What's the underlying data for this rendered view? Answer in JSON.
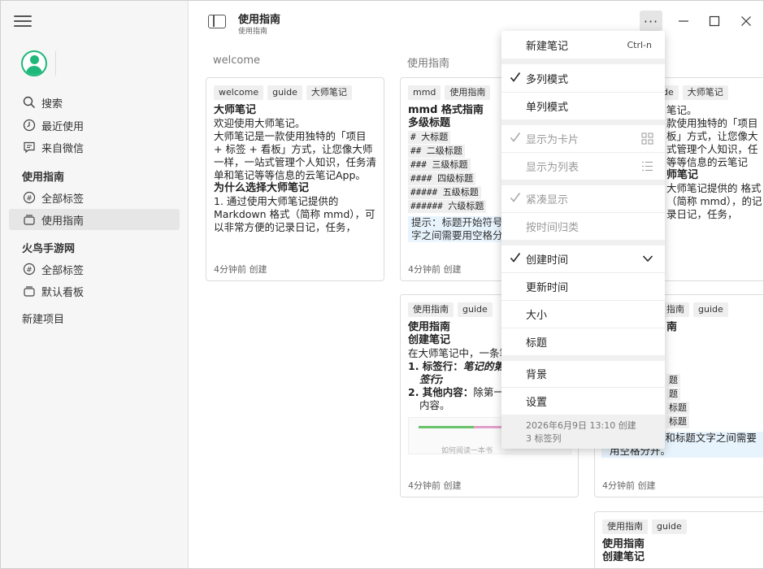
{
  "sidebar": {
    "nav_top": [
      {
        "label": "搜索",
        "icon": "search-icon"
      },
      {
        "label": "最近使用",
        "icon": "clock-icon"
      },
      {
        "label": "来自微信",
        "icon": "chat-icon"
      }
    ],
    "sections": [
      {
        "title": "使用指南",
        "items": [
          {
            "label": "全部标签",
            "icon": "tag-icon"
          },
          {
            "label": "使用指南",
            "icon": "board-icon",
            "active": true
          }
        ]
      },
      {
        "title": "火鸟手游网",
        "items": [
          {
            "label": "全部标签",
            "icon": "tag-icon"
          },
          {
            "label": "默认看板",
            "icon": "board-icon"
          }
        ]
      }
    ],
    "new_project": "新建项目"
  },
  "header": {
    "title": "使用指南",
    "subtitle": "使用指南",
    "more": "···"
  },
  "columns": [
    {
      "title": "welcome"
    },
    {
      "title": "使用指南"
    }
  ],
  "cards": {
    "c1": {
      "tags": [
        "welcome",
        "guide",
        "大师笔记"
      ],
      "title": "大师笔记",
      "lines": [
        "欢迎使用大师笔记。",
        "大师笔记是一款使用独特的「项目 + 标签 + 看板」方式，让您像大师一样，一站式管理个人知识，任务清单和笔记等等信息的云笔记App。"
      ],
      "h2": "为什么选择大师笔记",
      "p2": "1. 通过使用大师笔记提供的 Markdown 格式（简称 mmd），可以非常方便的记录日记，任务，",
      "footer": "4分钟前 创建"
    },
    "c2": {
      "tags": [
        "mmd",
        "使用指南"
      ],
      "title": "mmd 格式指南",
      "h2": "多级标题",
      "code": [
        "# 大标题",
        "## 二级标题",
        "### 三级标题",
        "#### 四级标题",
        "##### 五级标题",
        "###### 六级标题"
      ],
      "tip": "提示：标题开始符号 # 和标题文字之间需要用空格分开。",
      "footer": "4分钟前 创建"
    },
    "c3": {
      "tags": [
        "guide",
        "大师笔记"
      ],
      "lines": [
        "笔记。",
        "款使用独特的「项目",
        "板」方式，让您像大",
        "式管理个人知识，任",
        "等等信息的云笔记"
      ],
      "h2": "师笔记",
      "p2": "大师笔记提供的 格式（简称 mmd），的记录日记，任务，",
      "footer": ""
    },
    "c4": {
      "tags": [
        "使用指南",
        "guide"
      ],
      "title": "使用指南",
      "h2": "创建笔记",
      "p1": "在大师笔记中，一条笔记构成：",
      "li1_a": "1. 标签行：",
      "li1_b": "笔记的第",
      "li1_c": "签行;",
      "li2_a": "2. 其他内容：",
      "li2_b": "除第一",
      "li2_c": "内容。",
      "thumb_caption": "如何阅读一本书",
      "footer": "4分钟前 创建"
    },
    "c5": {
      "tags": [
        "指南",
        "guide"
      ],
      "title": "南",
      "code": [
        "题",
        "题",
        "标题",
        "标题"
      ],
      "tip": "开始符号 # 和标题文字之间需要用空格分开。",
      "footer": "4分钟前 创建"
    },
    "c6": {
      "tags": [
        "使用指南",
        "guide"
      ],
      "title": "使用指南",
      "h2": "创建笔记"
    }
  },
  "menu": {
    "new_note": "新建笔记",
    "new_note_shortcut": "Ctrl-n",
    "multi_col": "多列模式",
    "single_col": "单列模式",
    "as_card": "显示为卡片",
    "as_list": "显示为列表",
    "compact": "紧凑显示",
    "group_by_time": "按时间归类",
    "created_time": "创建时间",
    "updated_time": "更新时间",
    "size": "大小",
    "title": "标题",
    "background": "背景",
    "settings": "设置",
    "footer_date": "2026年6月9日 13:10 创建",
    "footer_count": "3 标签列"
  },
  "colors": {
    "accent_green": "#1db87a",
    "tip_bg": "#e8f4fd"
  }
}
